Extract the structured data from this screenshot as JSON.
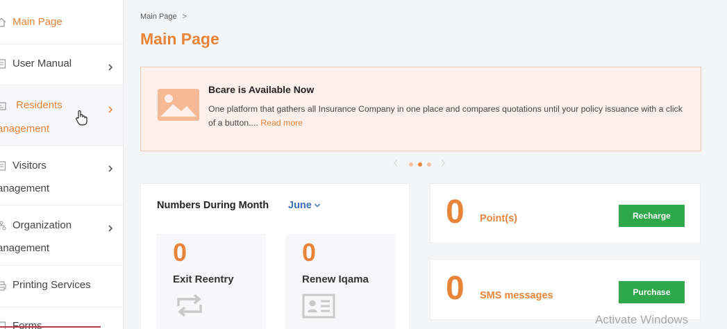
{
  "sidebar": {
    "items": [
      {
        "label": "Main Page"
      },
      {
        "label": "User Manual"
      },
      {
        "label": "Residents",
        "sub": "anagement"
      },
      {
        "label": "Visitors",
        "sub": "anagement"
      },
      {
        "label": "Organization",
        "sub": "anagement"
      },
      {
        "label": "Printing Services"
      },
      {
        "label": "Forms"
      }
    ]
  },
  "breadcrumb": {
    "item": "Main Page",
    "separator": ">"
  },
  "page_title": "Main Page",
  "banner": {
    "title": "Bcare is Available Now",
    "text": "One platform that gathers all Insurance Company in one place and compares quotations until your policy issuance with a click of a button....",
    "link": "Read more"
  },
  "numbers": {
    "title": "Numbers During Month",
    "month": "June",
    "stats": [
      {
        "value": "0",
        "label": "Exit Reentry",
        "icon": "reentry-icon"
      },
      {
        "value": "0",
        "label": "Renew Iqama",
        "icon": "id-card-icon"
      }
    ]
  },
  "points": {
    "value": "0",
    "label": "Point(s)",
    "button": "Recharge"
  },
  "sms": {
    "value": "0",
    "label": "SMS messages",
    "button": "Purchase"
  },
  "watermark": "Activate Windows",
  "colors": {
    "accent": "#e8833a",
    "button_green": "#2ea84a",
    "link_blue": "#3b6fb6"
  }
}
